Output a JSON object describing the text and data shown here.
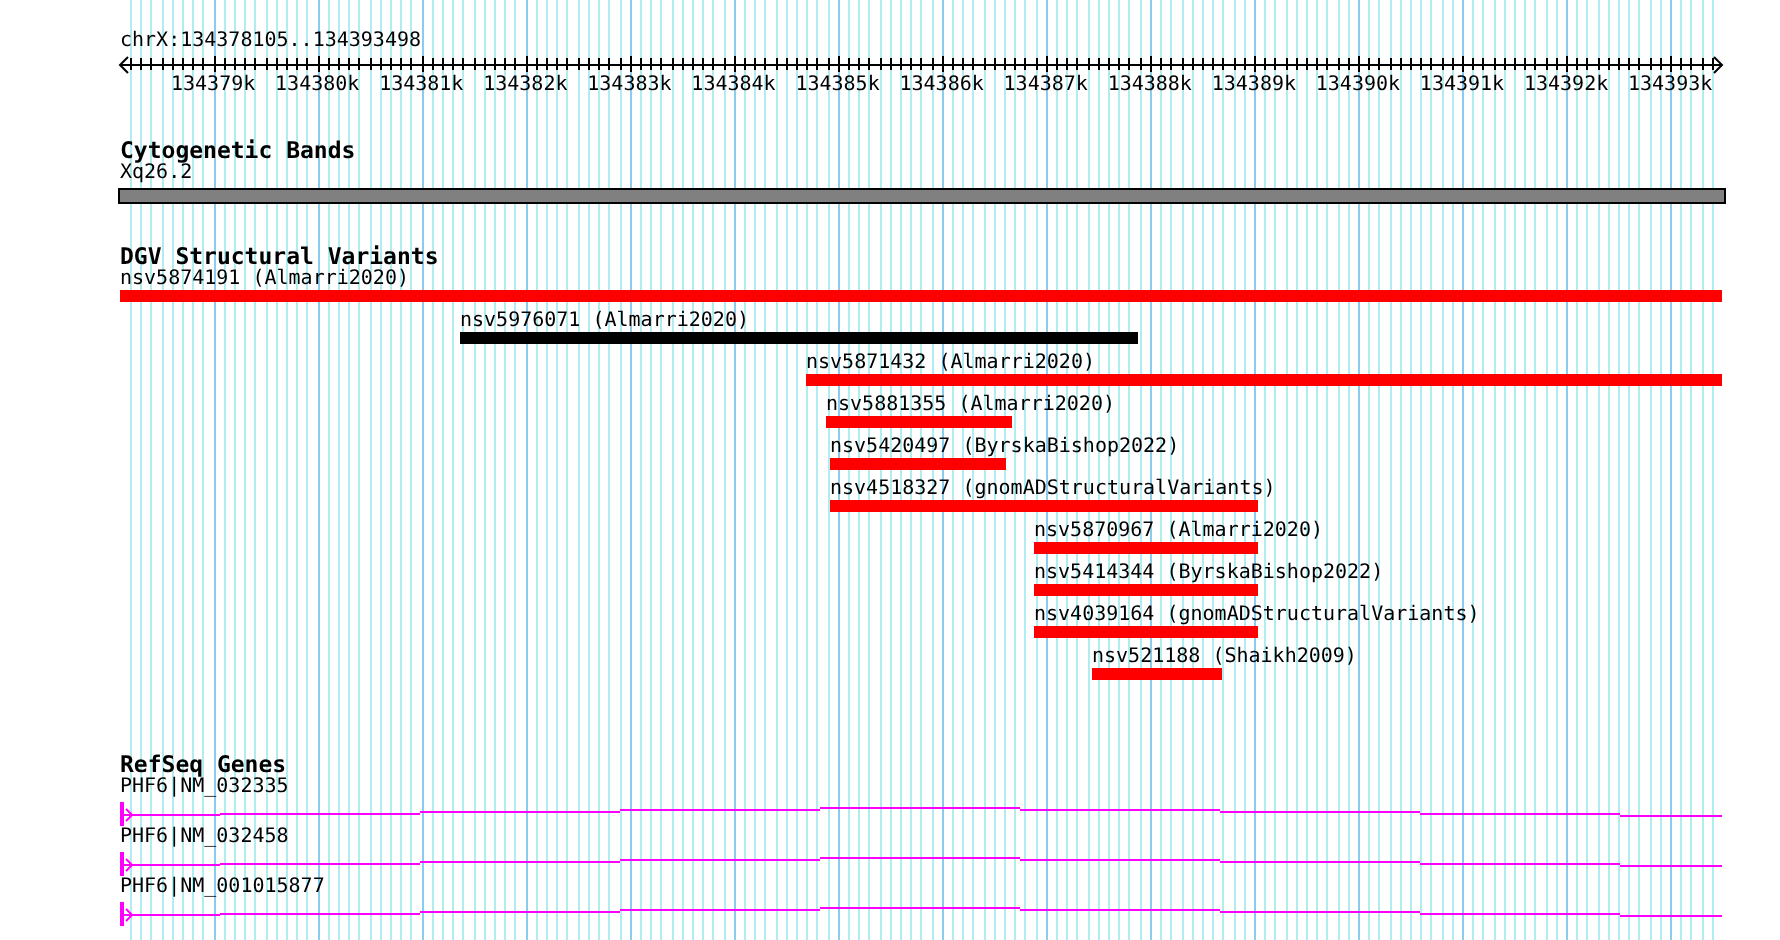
{
  "ruler": {
    "range": "chrX:134378105..134393498",
    "ticks": [
      "134379k",
      "134380k",
      "134381k",
      "134382k",
      "134383k",
      "134384k",
      "134385k",
      "134386k",
      "134387k",
      "134388k",
      "134389k",
      "134390k",
      "134391k",
      "134392k",
      "134393k"
    ]
  },
  "tracks": [
    {
      "kind": "bands",
      "title": "Cytogenetic Bands",
      "features": [
        {
          "label": "Xq26.2"
        }
      ]
    },
    {
      "kind": "variants",
      "title": "DGV Structural Variants",
      "features": [
        {
          "label": "nsv5874191 (Almarri2020)",
          "color": "#ff0000"
        },
        {
          "label": "nsv5976071 (Almarri2020)",
          "color": "#000000"
        },
        {
          "label": "nsv5871432 (Almarri2020)",
          "color": "#ff0000"
        },
        {
          "label": "nsv5881355 (Almarri2020)",
          "color": "#ff0000"
        },
        {
          "label": "nsv5420497 (ByrskaBishop2022)",
          "color": "#ff0000"
        },
        {
          "label": "nsv4518327 (gnomADStructuralVariants)",
          "color": "#ff0000"
        },
        {
          "label": "nsv5870967 (Almarri2020)",
          "color": "#ff0000"
        },
        {
          "label": "nsv5414344 (ByrskaBishop2022)",
          "color": "#ff0000"
        },
        {
          "label": "nsv4039164 (gnomADStructuralVariants)",
          "color": "#ff0000"
        },
        {
          "label": "nsv521188 (Shaikh2009)",
          "color": "#ff0000"
        }
      ]
    },
    {
      "kind": "genes",
      "title": "RefSeq Genes",
      "features": [
        {
          "label": "PHF6|NM_032335"
        },
        {
          "label": "PHF6|NM_032458"
        },
        {
          "label": "PHF6|NM_001015877"
        }
      ]
    }
  ]
}
